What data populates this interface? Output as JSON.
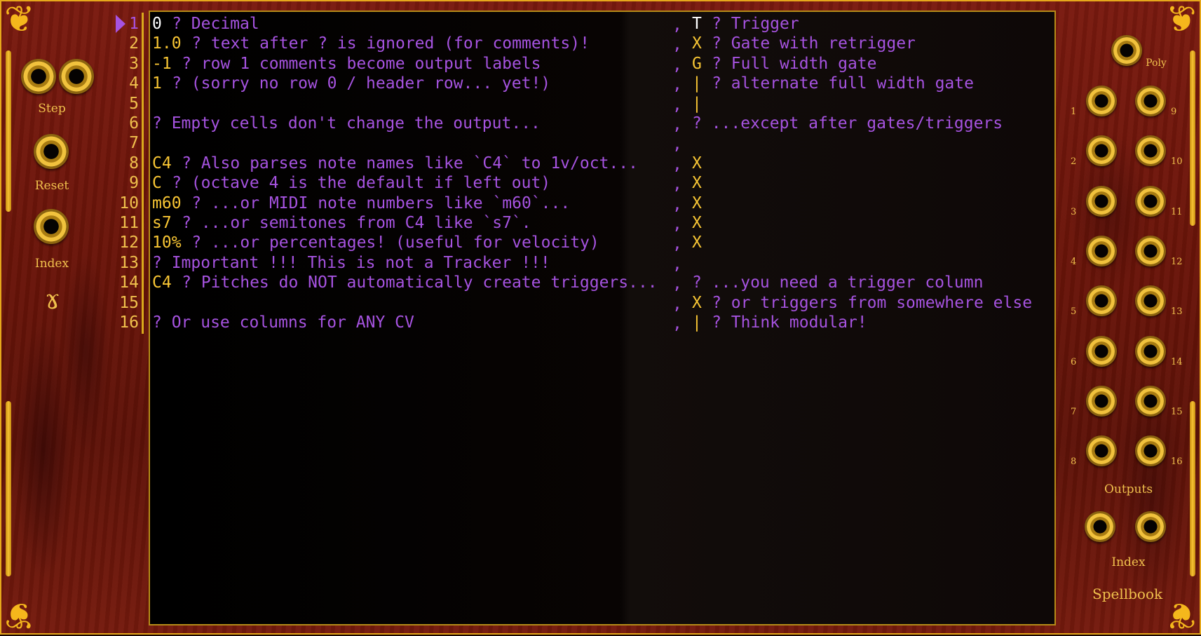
{
  "module_name": "Spellbook",
  "colors": {
    "panel": "#6a1409",
    "gold": "#f1c14d",
    "value": "#f7c534",
    "comment": "#a653e0",
    "screen": "#000000"
  },
  "left_controls": {
    "step_label": "Step",
    "reset_label": "Reset",
    "index_label": "Index"
  },
  "right_controls": {
    "poly_label": "Poly",
    "outputs_label": "Outputs",
    "index_label": "Index",
    "output_numbers_left": [
      "1",
      "2",
      "3",
      "4",
      "5",
      "6",
      "7",
      "8"
    ],
    "output_numbers_right": [
      "9",
      "10",
      "11",
      "12",
      "13",
      "14",
      "15",
      "16"
    ]
  },
  "current_row": 1,
  "rows": [
    {
      "n": "1",
      "c1v": "0",
      "c1c": "? Decimal",
      "c2v": "T",
      "c2c": "? Trigger",
      "sep": ","
    },
    {
      "n": "2",
      "c1v": "1.0",
      "c1c": "? text after ? is ignored (for comments)!",
      "c2v": "X",
      "c2c": "? Gate with retrigger",
      "sep": ","
    },
    {
      "n": "3",
      "c1v": "-1",
      "c1c": "? row 1 comments become output labels",
      "c2v": "G",
      "c2c": "? Full width gate",
      "sep": ","
    },
    {
      "n": "4",
      "c1v": "1",
      "c1c": "? (sorry no row 0 / header row... yet!)",
      "c2v": "|",
      "c2c": "? alternate full width gate",
      "sep": ","
    },
    {
      "n": "5",
      "c1v": "",
      "c1c": "",
      "c2v": "|",
      "c2c": "",
      "sep": ","
    },
    {
      "n": "6",
      "c1v": "",
      "c1c": "? Empty cells don't change the output...",
      "c2v": "",
      "c2c": "? ...except after gates/triggers",
      "sep": ","
    },
    {
      "n": "7",
      "c1v": "",
      "c1c": "",
      "c2v": "",
      "c2c": "",
      "sep": ","
    },
    {
      "n": "8",
      "c1v": "C4",
      "c1c": "? Also parses note names like `C4` to 1v/oct...",
      "c2v": "X",
      "c2c": "",
      "sep": ","
    },
    {
      "n": "9",
      "c1v": "C",
      "c1c": "? (octave 4 is the default if left out)",
      "c2v": "X",
      "c2c": "",
      "sep": ","
    },
    {
      "n": "10",
      "c1v": "m60",
      "c1c": "? ...or MIDI note numbers like `m60`...",
      "c2v": "X",
      "c2c": "",
      "sep": ","
    },
    {
      "n": "11",
      "c1v": "s7",
      "c1c": "? ...or semitones from C4 like `s7`.",
      "c2v": "X",
      "c2c": "",
      "sep": ","
    },
    {
      "n": "12",
      "c1v": "10%",
      "c1c": "? ...or percentages! (useful for velocity)",
      "c2v": "X",
      "c2c": "",
      "sep": ","
    },
    {
      "n": "13",
      "c1v": "",
      "c1c": "? Important !!! This is not a Tracker !!!",
      "c2v": "",
      "c2c": "",
      "sep": ","
    },
    {
      "n": "14",
      "c1v": "C4",
      "c1c": "? Pitches do NOT automatically create triggers...",
      "c2v": "",
      "c2c": "? ...you need a trigger column",
      "sep": ","
    },
    {
      "n": "15",
      "c1v": "",
      "c1c": "",
      "c2v": "X",
      "c2c": "? or triggers from somewhere else",
      "sep": ","
    },
    {
      "n": "16",
      "c1v": "",
      "c1c": "? Or use columns for ANY CV",
      "c2v": "|",
      "c2c": "? Think modular!",
      "sep": ","
    }
  ]
}
